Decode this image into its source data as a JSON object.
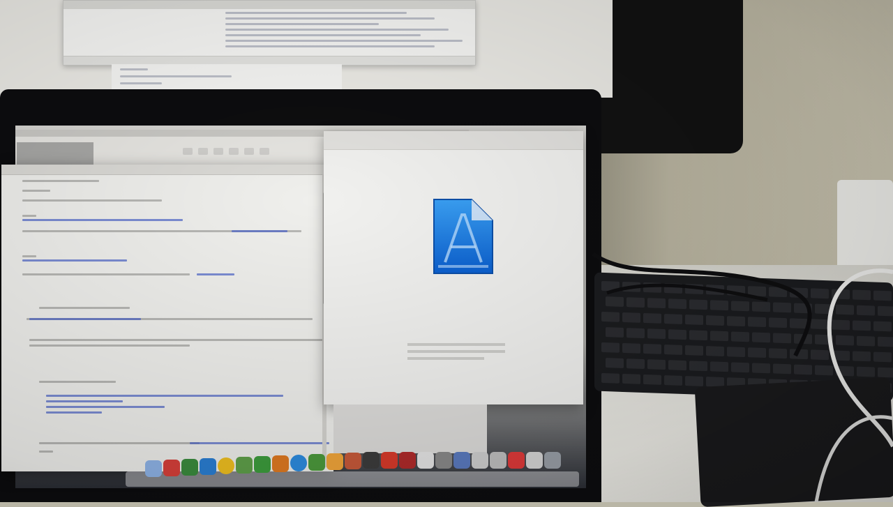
{
  "scene": {
    "description_labels": []
  },
  "monitor": {
    "text_lines": [
      "",
      "",
      ""
    ]
  },
  "editor": {
    "title": "",
    "headings": [
      "",
      "",
      ""
    ]
  },
  "info_window": {
    "title": "",
    "app_name": "",
    "subtitle": "",
    "rows": [
      {
        "label": "",
        "value": ""
      },
      {
        "label": "",
        "value": ""
      },
      {
        "label": "",
        "value": ""
      }
    ],
    "link": ""
  },
  "dock": {
    "icons": [
      "finder-icon",
      "app-icon",
      "app-icon",
      "app-icon",
      "chrome-icon",
      "app-icon",
      "app-icon",
      "app-icon",
      "safari-icon",
      "app-icon",
      "app-icon",
      "app-icon",
      "app-icon",
      "app-icon",
      "app-icon",
      "app-icon",
      "app-icon",
      "app-icon",
      "app-icon",
      "app-icon",
      "app-icon",
      "app-icon",
      "trash-icon"
    ]
  },
  "external_drive": {
    "label": ""
  },
  "colors": {
    "link_blue": "#4a63c7",
    "icon_blue": "#1f7fe0",
    "laptop_bezel": "#0d0d0f",
    "keyboard": "#1b1c1f"
  }
}
